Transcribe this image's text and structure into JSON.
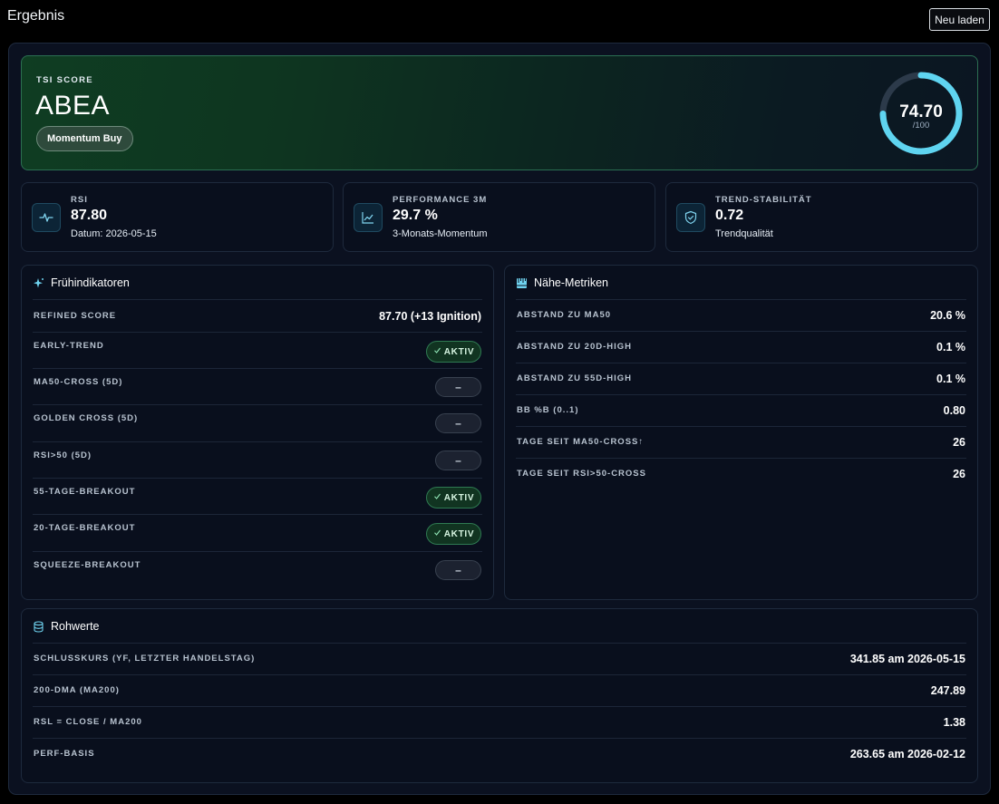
{
  "header": {
    "title": "Ergebnis",
    "reload_label": "Neu laden"
  },
  "hero": {
    "label": "TSI SCORE",
    "ticker": "ABEA",
    "badge": "Momentum Buy",
    "score": "74.70",
    "score_max": "/100",
    "score_fraction": 0.747,
    "ring_color": "#5fd4f0"
  },
  "stats": [
    {
      "label": "RSI",
      "value": "87.80",
      "sub": "Datum: 2026-05-15",
      "icon": "pulse-icon"
    },
    {
      "label": "PERFORMANCE 3M",
      "value": "29.7 %",
      "sub": "3-Monats-Momentum",
      "icon": "trend-up-icon"
    },
    {
      "label": "TREND-STABILITÄT",
      "value": "0.72",
      "sub": "Trendqualität",
      "icon": "shield-check-icon"
    }
  ],
  "early": {
    "title": "Frühindikatoren",
    "icon": "sparkle-icon",
    "score_label": "REFINED SCORE",
    "score_value": "87.70 (+13 Ignition)",
    "active_label": "AKTIV",
    "inactive_label": "–",
    "indicators": [
      {
        "label": "EARLY-TREND",
        "active": true
      },
      {
        "label": "MA50-CROSS (5D)",
        "active": false
      },
      {
        "label": "GOLDEN CROSS (5D)",
        "active": false
      },
      {
        "label": "RSI>50 (5D)",
        "active": false
      },
      {
        "label": "55-TAGE-BREAKOUT",
        "active": true
      },
      {
        "label": "20-TAGE-BREAKOUT",
        "active": true
      },
      {
        "label": "SQUEEZE-BREAKOUT",
        "active": false
      }
    ]
  },
  "proximity": {
    "title": "Nähe-Metriken",
    "icon": "ruler-icon",
    "rows": [
      {
        "label": "ABSTAND ZU MA50",
        "value": "20.6 %"
      },
      {
        "label": "ABSTAND ZU 20D-HIGH",
        "value": "0.1 %"
      },
      {
        "label": "ABSTAND ZU 55D-HIGH",
        "value": "0.1 %"
      },
      {
        "label": "BB %B (0..1)",
        "value": "0.80"
      },
      {
        "label": "TAGE SEIT MA50-CROSS↑",
        "value": "26"
      },
      {
        "label": "TAGE SEIT RSI>50-CROSS",
        "value": "26"
      }
    ]
  },
  "raw": {
    "title": "Rohwerte",
    "icon": "database-icon",
    "rows": [
      {
        "label": "SCHLUSSKURS (YF, LETZTER HANDELSTAG)",
        "value": "341.85 am 2026-05-15"
      },
      {
        "label": "200-DMA (MA200)",
        "value": "247.89"
      },
      {
        "label": "RSL = CLOSE / MA200",
        "value": "1.38"
      },
      {
        "label": "PERF-BASIS",
        "value": "263.65 am 2026-02-12"
      }
    ]
  }
}
